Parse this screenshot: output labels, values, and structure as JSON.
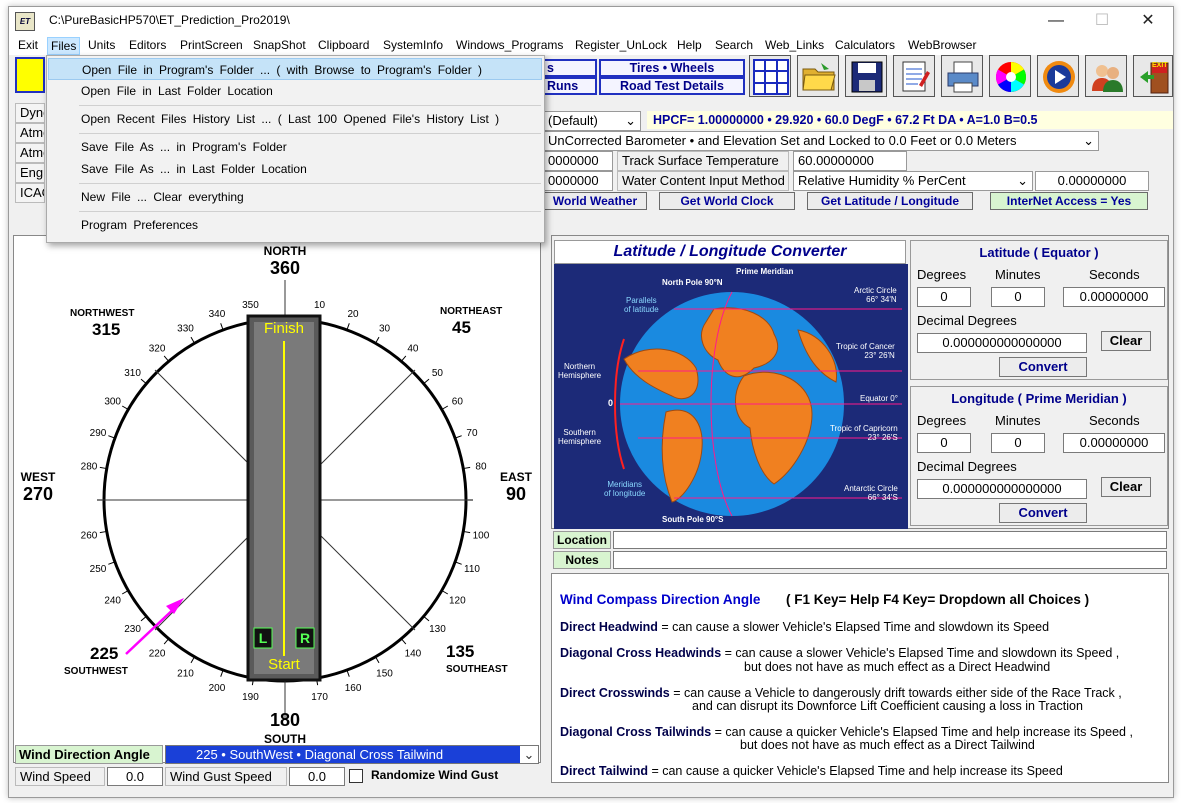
{
  "window": {
    "title": "C:\\PureBasicHP570\\ET_Prediction_Pro2019\\",
    "icon_text": "ET"
  },
  "menubar": [
    "Exit",
    "Files",
    "Units",
    "Editors",
    "PrintScreen",
    "SnapShot",
    "Clipboard",
    "SystemInfo",
    "Windows_Programs",
    "Register_UnLock",
    "Help",
    "Search",
    "Web_Links",
    "Calculators",
    "WebBrowser"
  ],
  "files_menu": {
    "items": [
      "Open File in Program's Folder ... ( with Browse to Program's Folder )",
      "Open File in Last Folder Location",
      "Open Recent Files History List ... ( Last 100 Opened File's History List )",
      "Save File As ... in Program's Folder",
      "Save File As ... in Last Folder Location",
      "New File ... Clear everything",
      "Program Preferences"
    ]
  },
  "toolbar": {
    "btn_s": "s",
    "btn_runs": "Runs",
    "btn_tires": "Tires  •  Wheels",
    "btn_road": "Road Test Details",
    "icons": [
      "grid-icon",
      "open-folder-icon",
      "save-disk-icon",
      "notepad-icon",
      "printer-icon",
      "color-wheel-icon",
      "media-player-icon",
      "users-icon",
      "exit-door-icon"
    ],
    "exit_label": "EXIT"
  },
  "left_labels": [
    "Dyno",
    "Atmo",
    "Atmo",
    "Engi",
    "ICAO"
  ],
  "settings": {
    "default_select": "(Default)",
    "hpcf": "HPCF= 1.00000000  •  29.920  •  60.0 DegF  •  67.2 Ft DA  •  A=1.0  B=0.5",
    "barometer_select": "UnCorrected Barometer  •  and  Elevation Set and Locked to 0.0 Feet or 0.0 Meters",
    "val1": "0000000",
    "val2": "0000000",
    "track_temp_label": "Track Surface Temperature",
    "track_temp_value": "60.00000000",
    "water_label": "Water Content Input Method",
    "humidity_select": "Relative Humidity  %  PerCent",
    "humidity_value": "0.00000000",
    "world_weather": "World Weather",
    "world_clock": "Get World Clock",
    "latlon_btn": "Get Latitude / Longitude",
    "internet": "InterNet Access = Yes"
  },
  "compass": {
    "north": "NORTH",
    "north_deg": "360",
    "south": "SOUTH",
    "south_deg": "180",
    "east": "EAST",
    "east_deg": "90",
    "west": "WEST",
    "west_deg": "270",
    "northeast": "NORTHEAST",
    "northeast_deg": "45",
    "northwest": "NORTHWEST",
    "northwest_deg": "315",
    "southeast": "SOUTHEAST",
    "southeast_deg": "135",
    "southwest": "SOUTHWEST",
    "southwest_deg": "225",
    "track_finish": "Finish",
    "track_start": "Start",
    "lane_left": "L",
    "lane_right": "R",
    "ticks": [
      "10",
      "20",
      "30",
      "40",
      "50",
      "60",
      "70",
      "80",
      "100",
      "110",
      "120",
      "130",
      "140",
      "150",
      "160",
      "170",
      "190",
      "200",
      "210",
      "220",
      "230",
      "240",
      "250",
      "260",
      "280",
      "290",
      "300",
      "310",
      "320",
      "330",
      "340",
      "350"
    ]
  },
  "wind": {
    "direction_label": "Wind Direction Angle",
    "direction_value": "225  •  SouthWest  •  Diagonal Cross Tailwind",
    "speed_label": "Wind Speed",
    "speed_value": "0.0",
    "gust_label": "Wind Gust Speed",
    "gust_value": "0.0",
    "randomize_label": "Randomize Wind Gust"
  },
  "converter": {
    "title": "Latitude / Longitude  Converter",
    "globe_labels": {
      "north_pole": "North Pole 90°N",
      "prime_meridian": "Prime Meridian",
      "parallels": "Parallels\nof latitude",
      "arctic": "Arctic Circle\n66° 34'N",
      "cancer": "Tropic of Cancer\n23° 26'N",
      "equator": "Equator 0°",
      "capricorn": "Tropic of Capricorn\n23° 26'S",
      "antarctic": "Antarctic Circle\n66° 34'S",
      "northern": "Northern\nHemisphere",
      "southern": "Southern\nHemisphere",
      "zero": "0",
      "meridians": "Meridians\nof longitude",
      "south_pole": "South Pole 90°S"
    },
    "lat_head": "Latitude ( Equator )",
    "lon_head": "Longitude ( Prime Meridian )",
    "degrees": "Degrees",
    "minutes": "Minutes",
    "seconds": "Seconds",
    "decimal": "Decimal  Degrees",
    "lat_deg": "0",
    "lat_min": "0",
    "lat_sec": "0.00000000",
    "lat_dec": "0.000000000000000",
    "lon_deg": "0",
    "lon_min": "0",
    "lon_sec": "0.00000000",
    "lon_dec": "0.000000000000000",
    "clear": "Clear",
    "convert": "Convert"
  },
  "location_label": "Location",
  "notes_label": "Notes",
  "help": {
    "title": "Wind Compass Direction Angle",
    "keys": "( F1 Key= Help   F4 Key= Dropdown all Choices )",
    "lines": [
      {
        "b": "Direct Headwind",
        "t": " = can cause a slower Vehicle's Elapsed Time and slowdown its Speed"
      },
      {
        "b": "Diagonal Cross Headwinds",
        "t": " = can cause a slower Vehicle's Elapsed Time and slowdown its Speed ,"
      },
      {
        "b": "",
        "t": "but does not have as much effect as a Direct Headwind"
      },
      {
        "b": "Direct Crosswinds",
        "t": " = can cause a Vehicle to dangerously drift towards either side of the Race Track ,"
      },
      {
        "b": "",
        "t": "and can disrupt its Downforce Lift Coefficient causing a loss in Traction"
      },
      {
        "b": "Diagonal Cross Tailwinds",
        "t": " = can cause a quicker Vehicle's Elapsed Time and help increase its Speed ,"
      },
      {
        "b": "",
        "t": "but does not have as much effect as a Direct Tailwind"
      },
      {
        "b": "Direct Tailwind",
        "t": " = can cause a quicker Vehicle's Elapsed Time and help increase its Speed"
      }
    ]
  }
}
